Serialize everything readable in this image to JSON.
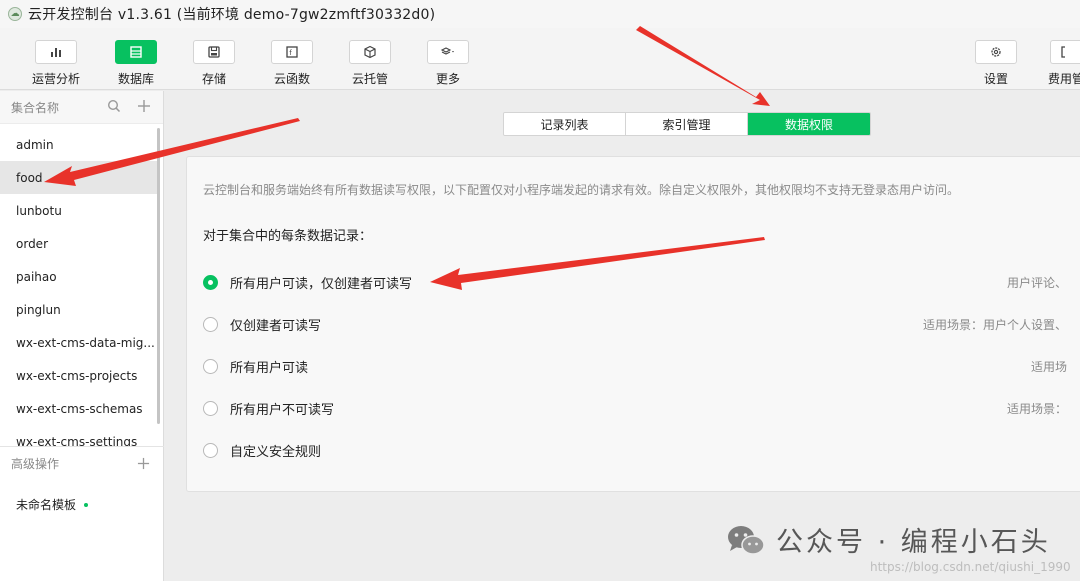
{
  "window": {
    "title": "云开发控制台 v1.3.61 (当前环境 demo-7gw2zmftf30332d0)"
  },
  "toolbar": {
    "items": [
      {
        "label": "运营分析",
        "icon": "bar-chart-icon"
      },
      {
        "label": "数据库",
        "icon": "database-icon",
        "active": true
      },
      {
        "label": "存储",
        "icon": "storage-icon"
      },
      {
        "label": "云函数",
        "icon": "function-icon"
      },
      {
        "label": "云托管",
        "icon": "cube-icon"
      },
      {
        "label": "更多",
        "icon": "layers-icon"
      },
      {
        "label": "设置",
        "icon": "gear-icon"
      },
      {
        "label": "费用管",
        "icon": "billing-icon"
      }
    ]
  },
  "sidebar": {
    "header": "集合名称",
    "collections": [
      "admin",
      "food",
      "lunbotu",
      "order",
      "paihao",
      "pinglun",
      "wx-ext-cms-data-mig...",
      "wx-ext-cms-projects",
      "wx-ext-cms-schemas",
      "wx-ext-cms-settings"
    ],
    "selected_index": 1,
    "advanced_header": "高级操作",
    "template_label": "未命名模板"
  },
  "tabs": [
    "记录列表",
    "索引管理",
    "数据权限"
  ],
  "active_tab": "数据权限",
  "permissions": {
    "notice": "云控制台和服务端始终有所有数据读写权限，以下配置仅对小程序端发起的请求有效。除自定义权限外，其他权限均不支持无登录态用户访问。",
    "subhead": "对于集合中的每条数据记录：",
    "options": [
      {
        "label": "所有用户可读，仅创建者可读写",
        "hint": "用户评论、",
        "checked": true
      },
      {
        "label": "仅创建者可读写",
        "hint": "适用场景：用户个人设置、",
        "checked": false
      },
      {
        "label": "所有用户可读",
        "hint": "适用场",
        "checked": false
      },
      {
        "label": "所有用户不可读写",
        "hint": "适用场景：",
        "checked": false
      },
      {
        "label": "自定义安全规则",
        "hint": "",
        "checked": false
      }
    ]
  },
  "watermark": {
    "text": "公众号 · 编程小石头",
    "url": "https://blog.csdn.net/qiushi_1990"
  },
  "colors": {
    "accent": "#07c160",
    "arrow": "#e8322a"
  }
}
